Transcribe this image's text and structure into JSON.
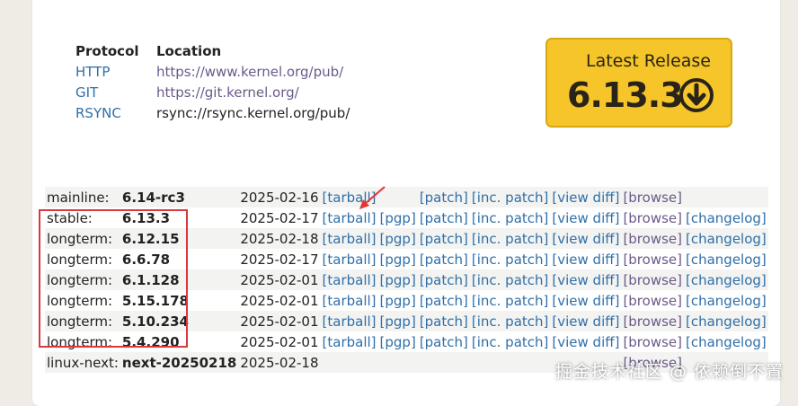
{
  "protocols": {
    "headers": {
      "protocol": "Protocol",
      "location": "Location"
    },
    "rows": [
      {
        "protocol": "HTTP",
        "location": "https://www.kernel.org/pub/"
      },
      {
        "protocol": "GIT",
        "location": "https://git.kernel.org/"
      },
      {
        "protocol": "RSYNC",
        "location": "rsync://rsync.kernel.org/pub/"
      }
    ]
  },
  "latest_release": {
    "label": "Latest Release",
    "version": "6.13.3",
    "icon": "download-circle-icon",
    "colors": {
      "background": "#f5c52a",
      "border": "#d7a812"
    }
  },
  "releases": [
    {
      "kind": "mainline:",
      "version": "6.14-rc3",
      "date": "2025-02-16",
      "links": [
        "[tarball]",
        "",
        "[patch]",
        "[inc. patch]",
        "[view diff]",
        "[browse]",
        ""
      ]
    },
    {
      "kind": "stable:",
      "version": "6.13.3",
      "date": "2025-02-17",
      "links": [
        "[tarball]",
        "[pgp]",
        "[patch]",
        "[inc. patch]",
        "[view diff]",
        "[browse]",
        "[changelog]"
      ]
    },
    {
      "kind": "longterm:",
      "version": "6.12.15",
      "date": "2025-02-18",
      "links": [
        "[tarball]",
        "[pgp]",
        "[patch]",
        "[inc. patch]",
        "[view diff]",
        "[browse]",
        "[changelog]"
      ]
    },
    {
      "kind": "longterm:",
      "version": "6.6.78",
      "date": "2025-02-17",
      "links": [
        "[tarball]",
        "[pgp]",
        "[patch]",
        "[inc. patch]",
        "[view diff]",
        "[browse]",
        "[changelog]"
      ]
    },
    {
      "kind": "longterm:",
      "version": "6.1.128",
      "date": "2025-02-01",
      "links": [
        "[tarball]",
        "[pgp]",
        "[patch]",
        "[inc. patch]",
        "[view diff]",
        "[browse]",
        "[changelog]"
      ]
    },
    {
      "kind": "longterm:",
      "version": "5.15.178",
      "date": "2025-02-01",
      "links": [
        "[tarball]",
        "[pgp]",
        "[patch]",
        "[inc. patch]",
        "[view diff]",
        "[browse]",
        "[changelog]"
      ]
    },
    {
      "kind": "longterm:",
      "version": "5.10.234",
      "date": "2025-02-01",
      "links": [
        "[tarball]",
        "[pgp]",
        "[patch]",
        "[inc. patch]",
        "[view diff]",
        "[browse]",
        "[changelog]"
      ]
    },
    {
      "kind": "longterm:",
      "version": "5.4.290",
      "date": "2025-02-01",
      "links": [
        "[tarball]",
        "[pgp]",
        "[patch]",
        "[inc. patch]",
        "[view diff]",
        "[browse]",
        "[changelog]"
      ]
    },
    {
      "kind": "linux-next:",
      "version": "next-20250218",
      "date": "2025-02-18",
      "links": [
        "",
        "",
        "",
        "",
        "",
        "[browse]",
        ""
      ]
    }
  ],
  "annotations": {
    "highlight_color": "#d73a3a",
    "arrow_icon": "red-arrow-icon"
  },
  "watermark": "掘金技术社区 @ 依赖倒不置"
}
